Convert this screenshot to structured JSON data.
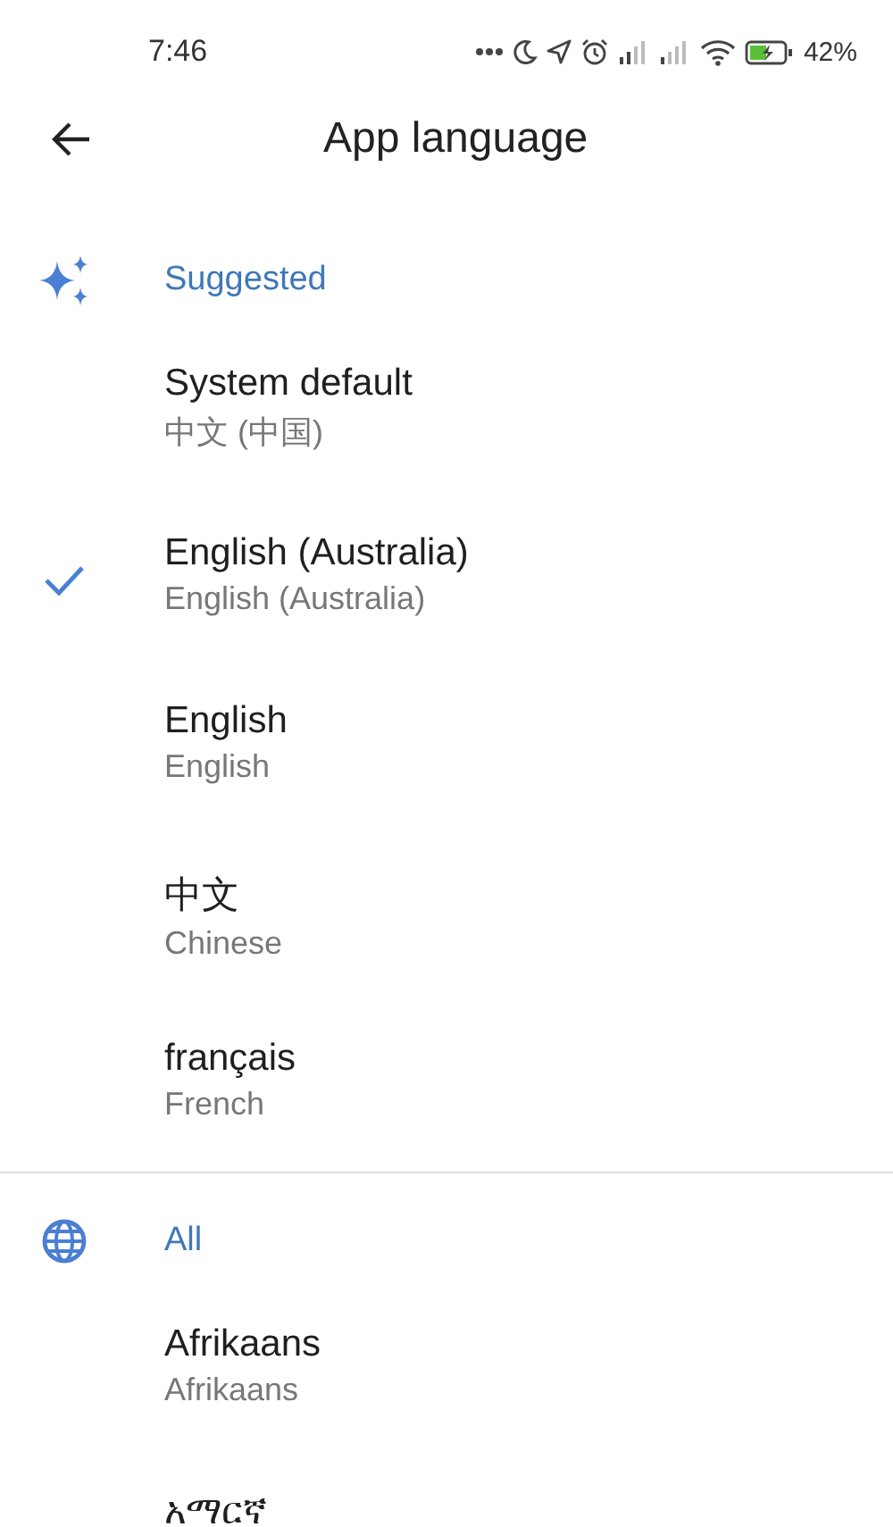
{
  "status_bar": {
    "time": "7:46",
    "battery": "42%"
  },
  "header": {
    "title": "App language"
  },
  "sections": [
    {
      "kind": "suggested",
      "title": "Suggested",
      "items": [
        {
          "title": "System default",
          "subtitle": "中文 (中国)",
          "selected": false
        },
        {
          "title": "English (Australia)",
          "subtitle": "English (Australia)",
          "selected": true
        },
        {
          "title": "English",
          "subtitle": "English",
          "selected": false
        },
        {
          "title": "中文",
          "subtitle": "Chinese",
          "selected": false
        },
        {
          "title": "français",
          "subtitle": "French",
          "selected": false
        }
      ]
    },
    {
      "kind": "all",
      "title": "All",
      "items": [
        {
          "title": "Afrikaans",
          "subtitle": "Afrikaans",
          "selected": false
        },
        {
          "title": "አማርኛ",
          "selected": false
        }
      ]
    }
  ]
}
